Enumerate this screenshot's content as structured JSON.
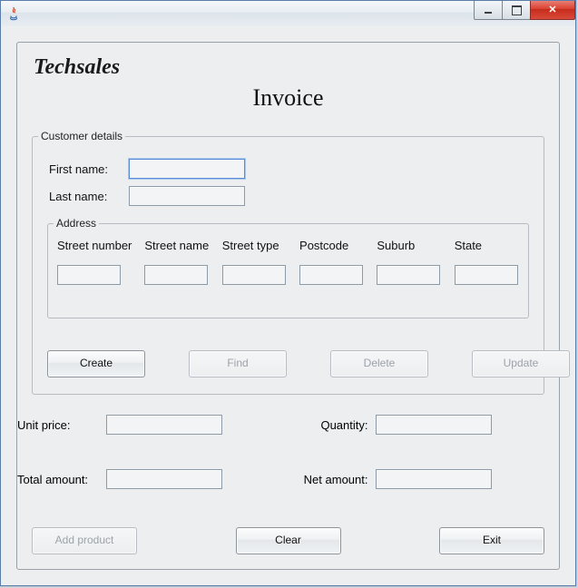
{
  "window": {
    "title": ""
  },
  "brand": "Techsales",
  "page_title": "Invoice",
  "customer": {
    "legend": "Customer details",
    "first_label": "First name:",
    "first_value": "",
    "last_label": "Last name:",
    "last_value": ""
  },
  "address": {
    "legend": "Address",
    "cols": [
      {
        "label": "Street number",
        "value": ""
      },
      {
        "label": "Street name",
        "value": ""
      },
      {
        "label": "Street type",
        "value": ""
      },
      {
        "label": "Postcode",
        "value": ""
      },
      {
        "label": "Suburb",
        "value": ""
      },
      {
        "label": "State",
        "value": ""
      }
    ]
  },
  "cust_buttons": {
    "create": "Create",
    "find": "Find",
    "delete": "Delete",
    "update": "Update"
  },
  "money": {
    "unit_price_label": "Unit price:",
    "unit_price_value": "",
    "quantity_label": "Quantity:",
    "quantity_value": "",
    "total_label": "Total amount:",
    "total_value": "",
    "net_label": "Net amount:",
    "net_value": ""
  },
  "bottom": {
    "add_product": "Add product",
    "clear": "Clear",
    "exit": "Exit"
  }
}
